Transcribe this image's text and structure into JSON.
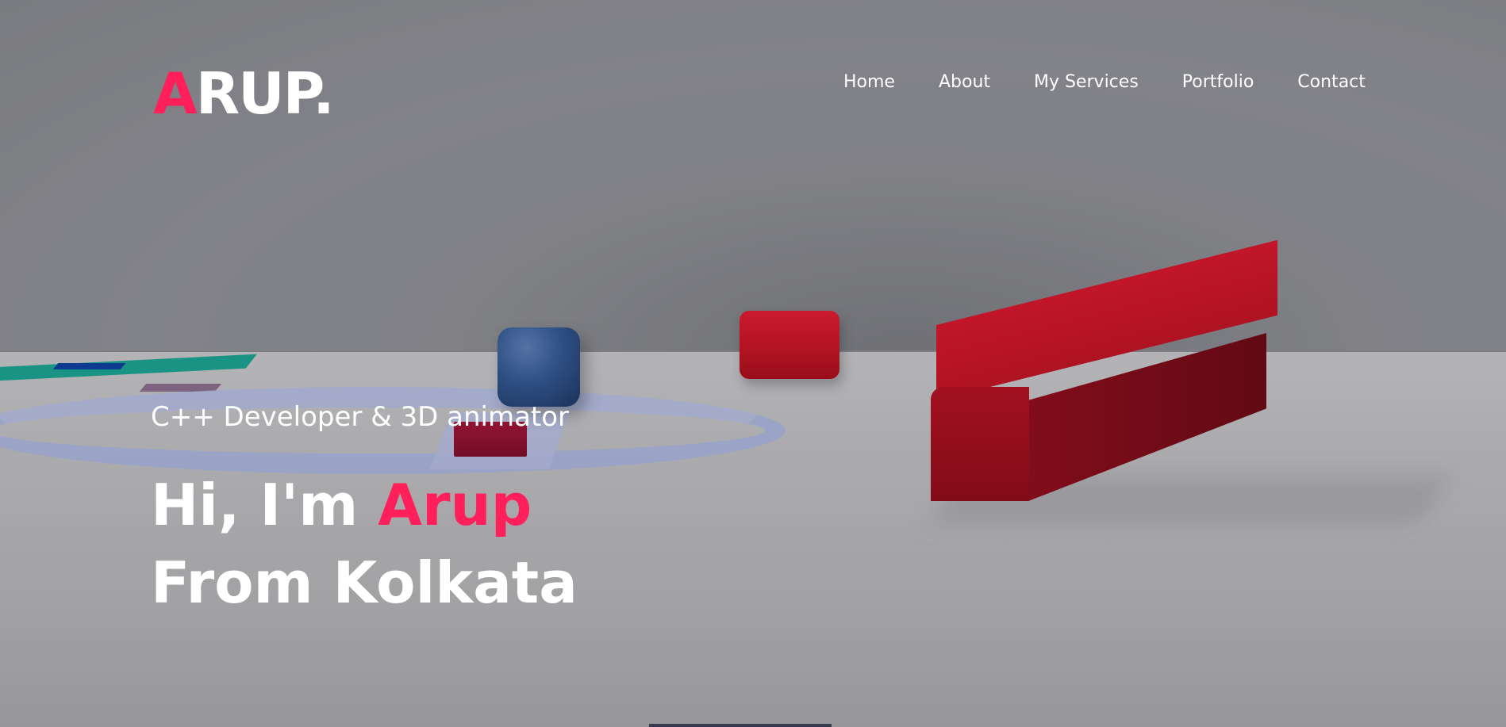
{
  "brand": {
    "logo_accent": "A",
    "logo_rest": "RUP.",
    "accent_color": "#ff1f5a"
  },
  "nav": {
    "items": [
      {
        "label": "Home"
      },
      {
        "label": "About"
      },
      {
        "label": "My Services"
      },
      {
        "label": "Portfolio"
      },
      {
        "label": "Contact"
      }
    ]
  },
  "hero": {
    "subtitle": "C++ Developer & 3D animator",
    "greeting": "Hi, I'm ",
    "name": "Arup",
    "location_line": "From Kolkata"
  }
}
